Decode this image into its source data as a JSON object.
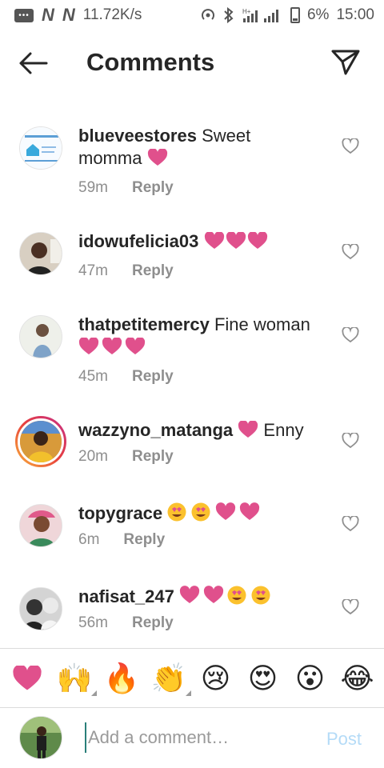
{
  "status_bar": {
    "speed": "11.72K/s",
    "battery": "6%",
    "time": "15:00",
    "icons": [
      "message-icon",
      "n-notification-icon",
      "n-notification-icon",
      "hotspot-icon",
      "bluetooth-icon",
      "signal-icon",
      "battery-icon"
    ]
  },
  "header": {
    "title": "Comments",
    "back_icon": "arrow-left-icon",
    "share_icon": "send-icon"
  },
  "comments": [
    {
      "username": "blueveestores",
      "text": "Sweet momma",
      "emoji": "❤",
      "time": "59m",
      "reply": "Reply"
    },
    {
      "username": "idowufelicia03",
      "text": "",
      "emoji": "❤ ❤ ❤",
      "time": "47m",
      "reply": "Reply"
    },
    {
      "username": "thatpetitemercy",
      "text": "Fine woman",
      "emoji": "❤ ❤ ❤",
      "time": "45m",
      "reply": "Reply"
    },
    {
      "username": "wazzyno_matanga",
      "text": "Enny",
      "emoji": "❤",
      "time": "20m",
      "reply": "Reply"
    },
    {
      "username": "topygrace",
      "text": "",
      "emoji": "😍😍❤❤",
      "time": "6m",
      "reply": "Reply"
    },
    {
      "username": "nafisat_247",
      "text": "",
      "emoji": "❤❤😍😍",
      "time": "56m",
      "reply": "Reply"
    }
  ],
  "emoji_bar": [
    "❤",
    "🙌",
    "🔥",
    "👏",
    "😢",
    "😍",
    "😮",
    "😂"
  ],
  "input": {
    "placeholder": "Add a comment…",
    "post_label": "Post"
  },
  "colors": {
    "heart": "#e0508c",
    "meta": "#8e8e8e",
    "post_disabled": "#b4dbf7",
    "cursor": "#2a7f7a"
  }
}
